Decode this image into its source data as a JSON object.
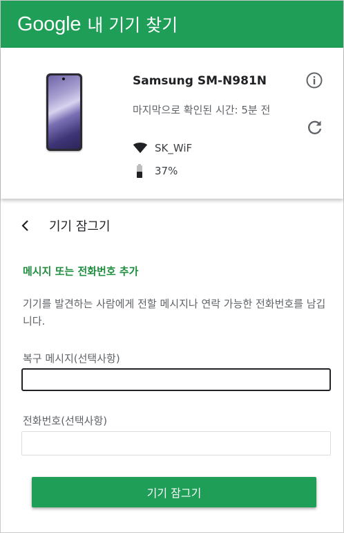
{
  "header": {
    "logo_text": "Google",
    "app_title": "내 기기 찾기",
    "brand_color": "#1e9e57"
  },
  "device": {
    "model": "Samsung SM-N981N",
    "last_seen": "마지막으로 확인된 시간: 5분 전",
    "wifi_name": "SK_WiF",
    "battery": "37%",
    "battery_level": 0.37,
    "icons": [
      "info-icon",
      "refresh-icon",
      "wifi-icon",
      "battery-icon"
    ]
  },
  "lock_panel": {
    "back_title": "기기 잠그기",
    "section_title": "메시지 또는 전화번호 추가",
    "section_title_color": "#1e8e3e",
    "description": "기기를 발견하는 사람에게 전할 메시지나 연락 가능한 전화번호를 남깁니다.",
    "message_label": "복구 메시지(선택사항)",
    "message_value": "",
    "phone_label": "전화번호(선택사항)",
    "phone_value": "",
    "lock_button_label": "기기 잠그기"
  }
}
